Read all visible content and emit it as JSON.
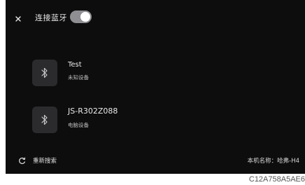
{
  "header": {
    "close_icon": "close-icon",
    "title": "连接蓝牙",
    "bluetooth_toggle_on": true
  },
  "devices": [
    {
      "icon": "bluetooth-icon",
      "name": "Test",
      "type": "未知设备"
    },
    {
      "icon": "bluetooth-icon",
      "name": "JS-R302Z088",
      "type": "电脑设备"
    }
  ],
  "footer": {
    "refresh_icon": "refresh-icon",
    "refresh_label": "重新搜索",
    "device_name": "本机名称：哈弗-H4"
  },
  "caption": "C12A758A5AE6",
  "colors": {
    "screen_bg": "#0d0d0e",
    "toggle_bg": "#8e8e93",
    "icon_box_bg": "#2b2b2e"
  }
}
